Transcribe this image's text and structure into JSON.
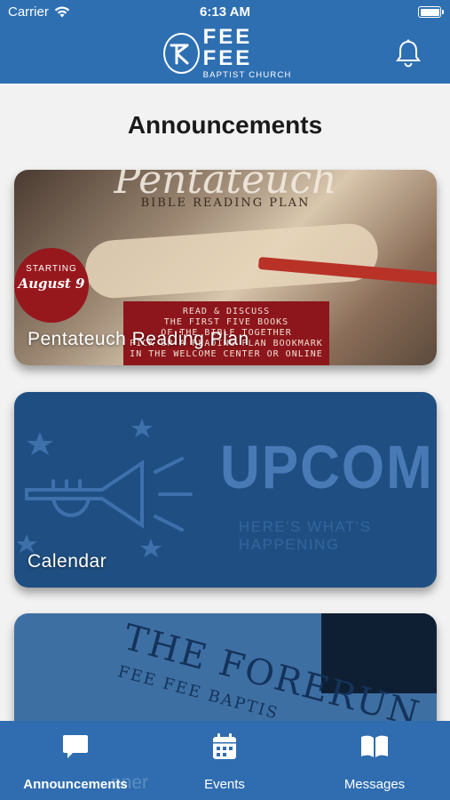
{
  "status": {
    "carrier": "Carrier",
    "time": "6:13 AM"
  },
  "header": {
    "logo_main": "FEE FEE",
    "logo_sub": "BAPTIST CHURCH",
    "bell_icon": "bell-icon"
  },
  "page": {
    "title": "Announcements"
  },
  "cards": [
    {
      "label": "Pentateuch Reading Plan",
      "art": {
        "title": "Pentateuch",
        "subtitle": "BIBLE READING PLAN",
        "badge_line1": "STARTING",
        "badge_line2": "August 9",
        "box_line1": "READ & DISCUSS",
        "box_line2": "THE FIRST FIVE BOOKS",
        "box_line3": "OF THE BIBLE TOGETHER",
        "box_line4": "PICK UP A READING PLAN BOOKMARK",
        "box_line5": "IN THE WELCOME CENTER OR ONLINE"
      }
    },
    {
      "label": "Calendar",
      "art": {
        "title": "UPCOMING",
        "subtitle": "HERE'S WHAT'S HAPPENING"
      }
    },
    {
      "label": "",
      "art": {
        "title": "THE FORERUN",
        "subtitle": "FEE FEE BAPTIS",
        "ghost_label": "nner"
      }
    }
  ],
  "tabbar": {
    "tabs": [
      {
        "label": "Announcements",
        "icon": "chat-bubble-icon",
        "active": true
      },
      {
        "label": "Events",
        "icon": "calendar-icon",
        "active": false
      },
      {
        "label": "Messages",
        "icon": "book-open-icon",
        "active": false
      }
    ]
  },
  "colors": {
    "primary": "#2e6fb2",
    "tabbar": "#2f6db0",
    "background": "#f2f2f2"
  }
}
